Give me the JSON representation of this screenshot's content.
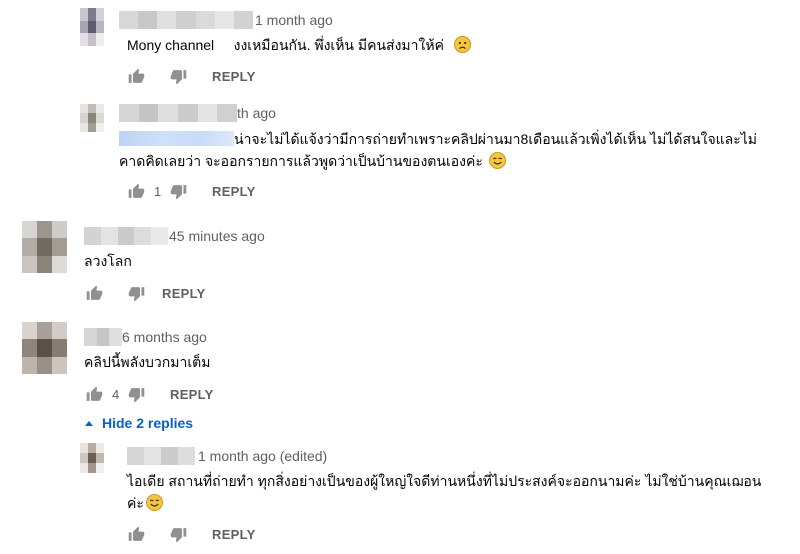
{
  "comments": [
    {
      "time": "1 month ago",
      "mention": "Mony channel",
      "text": "งงเหมือนกัน. พึ่งเห็น มีคนส่งมาให้ค่",
      "emoji": "sad-face-emoji",
      "likes": "",
      "reply_label": "REPLY"
    },
    {
      "time": "th ago",
      "text_line1": "น่าจะไม่ได้แจ้งว่ามีการถ่ายทำเพราะคลิปผ่านมา8เดือนแล้วเพิ่งได้เห็น  ไม่ได้สนใจและไม่",
      "text_line2": "คาดคิดเลยว่า จะออกรายการแล้วพูดว่าเป็นบ้านของตนเองค่ะ",
      "emoji": "smile-emoji",
      "likes": "1",
      "reply_label": "REPLY"
    },
    {
      "time": "45 minutes ago",
      "text": "ลวงโลก",
      "likes": "",
      "reply_label": "REPLY"
    },
    {
      "time": "6 months ago",
      "text": "คลิปนี้พลังบวกมาเต็ม",
      "likes": "4",
      "reply_label": "REPLY",
      "toggle_label": "Hide 2 replies"
    },
    {
      "time": "1 month ago (edited)",
      "text_line1": "ไอเดีย สถานที่ถ่ายทำ ทุกสิ่งอย่างเป็นของผู้ใหญ่ใจดีท่านหนึ่งที่ไม่ประสงค์จะออกนามค่ะ ไม่ใช่บ้านคุณเฌอน",
      "text_line2": "ค่ะ",
      "emoji": "smile-emoji",
      "likes": "",
      "reply_label": "REPLY"
    }
  ],
  "colors": {
    "link": "#065fd4",
    "meta": "#606060",
    "icon": "#909090"
  }
}
